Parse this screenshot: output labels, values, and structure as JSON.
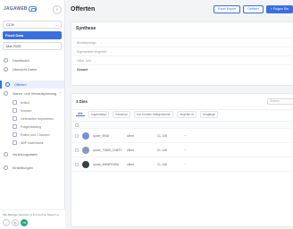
{
  "app": {
    "logo_text": "JAGAWEB",
    "page_title": "Offerten"
  },
  "colors": {
    "accent": "#3b6fe0",
    "active_bg": "#eaf0fc",
    "status_green": "#2aa876"
  },
  "sidebar": {
    "org_select": "CCN",
    "period_button": "Fixed Data",
    "period_select": "Mai 2025",
    "items": [
      {
        "label": "Dashboard",
        "icon": "grid-icon"
      },
      {
        "label": "Übersicht Daten",
        "icon": "chart-icon"
      },
      {
        "label": "Offerten",
        "icon": "document-icon",
        "active": true
      },
      {
        "label": "Waren- und Verkaufsplanung",
        "icon": "box-icon",
        "expanded": true
      }
    ],
    "sub_items": [
      {
        "label": "Artikel",
        "icon": "tag-icon"
      },
      {
        "label": "Kunden",
        "icon": "users-icon"
      },
      {
        "label": "Lieferanten Importieren",
        "icon": "import-icon"
      },
      {
        "label": "Fragenkatalog",
        "icon": "list-icon"
      },
      {
        "label": "Rollen und Chancen",
        "icon": "role-icon"
      },
      {
        "label": "ABP Datenbank",
        "icon": "database-icon"
      }
    ],
    "bottom_items": [
      {
        "label": "Verteilungsdaten",
        "icon": "share-icon"
      },
      {
        "label": "Einstellungen",
        "icon": "gear-icon"
      }
    ],
    "footer_text": "Alle Beiträge beziehen in € und ohne Steuern a",
    "footer_badge": "YB"
  },
  "toolbar": {
    "export_label": "Excel Export",
    "download_label": "Gefiltert",
    "add_label": "+ Folgen Sie"
  },
  "synthese": {
    "title": "Synthese",
    "rows": [
      {
        "label": "Bestellanträge"
      },
      {
        "label": "Eigenanteile eingeben"
      },
      {
        "label": "Offen Jahr"
      },
      {
        "label": "Gesamt",
        "emphasis": true
      }
    ]
  },
  "list": {
    "count_label": "3 Dies",
    "search_placeholder": "Suchen",
    "tab_all": "Alle",
    "filters": [
      "Angebotstyp",
      "Kassenal",
      "Von Kunden Kategorisieren",
      "Angebot ID",
      "Eingänge"
    ],
    "rows": [
      {
        "name": "quote_5948",
        "client": "client",
        "amount": "CL 148",
        "avatar_color": "#7a8fd8"
      },
      {
        "name": "quote_71880_CNEF1",
        "client": "client",
        "amount": "CL 148",
        "avatar_color": "#8a9ab8"
      },
      {
        "name": "quote_ANWFKN9A",
        "client": "client",
        "amount": "CL 148",
        "avatar_color": "#3a3f4a"
      }
    ]
  }
}
